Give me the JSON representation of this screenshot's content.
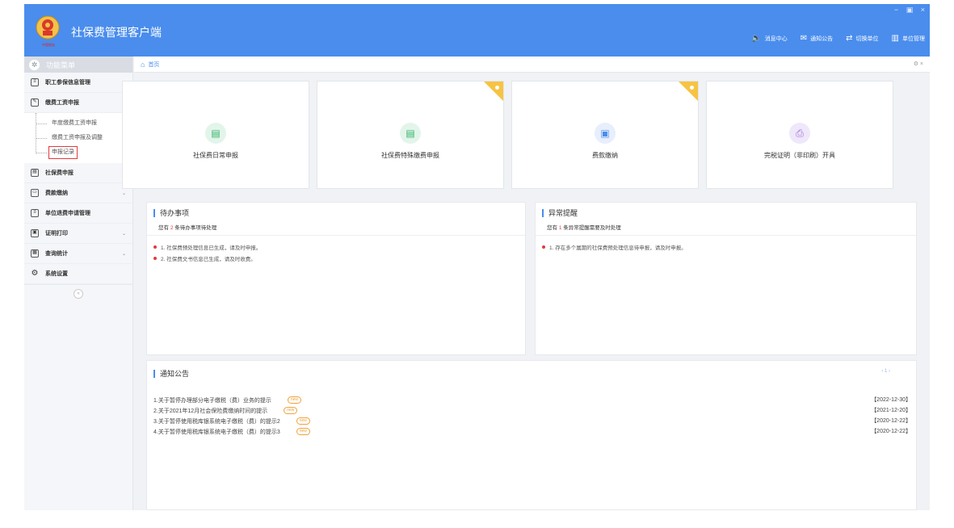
{
  "header": {
    "app_title": "社保费管理客户端",
    "logo_caption": "中国税务",
    "window_controls": {
      "minimize": "−",
      "restore": "▣",
      "close": "×"
    },
    "nav": [
      {
        "label": "消息中心",
        "icon": "speaker-icon"
      },
      {
        "label": "通知公告",
        "icon": "mail-icon"
      },
      {
        "label": "切换单位",
        "icon": "switch-icon"
      },
      {
        "label": "单位管理",
        "icon": "building-icon"
      }
    ]
  },
  "sidebar": {
    "header_label": "功能菜单",
    "items": [
      {
        "label": "职工参保信息管理",
        "icon": "list-icon",
        "has_chevron": false
      },
      {
        "label": "缴费工资申报",
        "icon": "edit-icon",
        "chevron": "⌃",
        "expanded": true
      },
      {
        "label": "社保费申报",
        "icon": "calc-icon",
        "chevron": "⌄"
      },
      {
        "label": "费款缴纳",
        "icon": "card-icon",
        "chevron": "⌄"
      },
      {
        "label": "单位退费申请管理",
        "icon": "refund-icon",
        "has_chevron": false
      },
      {
        "label": "证明打印",
        "icon": "print-icon",
        "chevron": "⌄"
      },
      {
        "label": "查询统计",
        "icon": "chart-icon",
        "chevron": "⌄"
      },
      {
        "label": "系统设置",
        "icon": "gear-icon",
        "has_chevron": false
      }
    ],
    "subitems": [
      {
        "label": "年度缴费工资申报"
      },
      {
        "label": "缴费工资申报及调整"
      },
      {
        "label": "申报记录",
        "active": true
      }
    ],
    "collapse_label": "«"
  },
  "breadcrumb": {
    "home_label": "首页",
    "tools": "⚙ ×"
  },
  "cards": [
    {
      "label": "社保费日常申报",
      "icon": "document-icon",
      "icon_bg": "#e3f5ea",
      "icon_color": "#35b36a",
      "badge": false
    },
    {
      "label": "社保费特殊缴费申报",
      "icon": "document-icon",
      "icon_bg": "#e3f5ea",
      "icon_color": "#35b36a",
      "badge": true
    },
    {
      "label": "费款缴纳",
      "icon": "bookmark-icon",
      "icon_bg": "#e7eefc",
      "icon_color": "#4a8ded",
      "badge": true
    },
    {
      "label": "完税证明（非印刷）开具",
      "icon": "printer-icon",
      "icon_bg": "#efe7fa",
      "icon_color": "#9b6bd6",
      "badge": false
    }
  ],
  "todo": {
    "title": "待办事项",
    "sub_prefix": "您有",
    "count": "2",
    "sub_suffix": "条待办事项待处理",
    "items": [
      "1. 社保费预处理信息已生成，请及时申报。",
      "2. 社保费文书信息已生成，请及时收费。"
    ]
  },
  "alert": {
    "title": "异常提醒",
    "sub_prefix": "您有",
    "count": "1",
    "sub_suffix": "条异常提醒需要及时处理",
    "items": [
      "1. 存在多个属期的社保费预处理信息待申报，请及时申报。"
    ]
  },
  "notice": {
    "title": "通知公告",
    "pager": "‹ 1 ›",
    "badge_label": "new",
    "items": [
      {
        "text": "1.关于暂停办理部分电子缴税（费）业务的提示",
        "date": "【2022-12-30】"
      },
      {
        "text": "2.关于2021年12月社会保险费缴纳时间的提示",
        "date": "【2021-12-20】"
      },
      {
        "text": "3.关于暂停使用税库银系统电子缴税（费）的提示2",
        "date": "【2020-12-22】"
      },
      {
        "text": "4.关于暂停使用税库银系统电子缴税（费）的提示3",
        "date": "【2020-12-22】"
      }
    ]
  }
}
